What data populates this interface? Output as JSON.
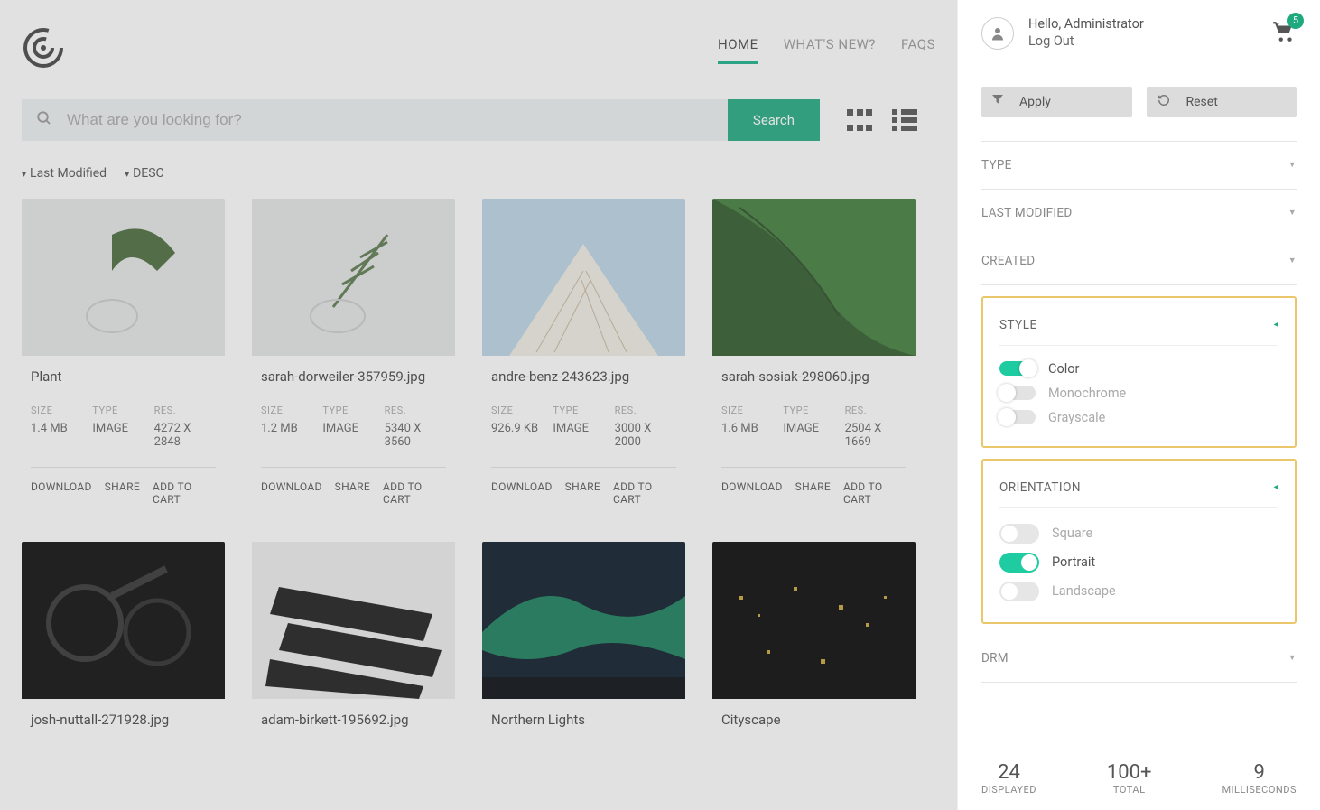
{
  "nav": {
    "home": "HOME",
    "whatsnew": "WHAT'S NEW?",
    "faqs": "FAQS"
  },
  "search": {
    "placeholder": "What are you looking for?",
    "button": "Search"
  },
  "sort": {
    "field": "Last Modified",
    "dir": "DESC"
  },
  "labels": {
    "size": "SIZE",
    "type": "TYPE",
    "res": "RES."
  },
  "actions": {
    "download": "DOWNLOAD",
    "share": "SHARE",
    "addcart": "ADD TO CART"
  },
  "cards": [
    {
      "title": "Plant",
      "size": "1.4 MB",
      "type": "IMAGE",
      "res": "4272 X 2848"
    },
    {
      "title": "sarah-dorweiler-357959.jpg",
      "size": "1.2 MB",
      "type": "IMAGE",
      "res": "5340 X 3560"
    },
    {
      "title": "andre-benz-243623.jpg",
      "size": "926.9 KB",
      "type": "IMAGE",
      "res": "3000 X 2000"
    },
    {
      "title": "sarah-sosiak-298060.jpg",
      "size": "1.6 MB",
      "type": "IMAGE",
      "res": "2504 X 1669"
    },
    {
      "title": "josh-nuttall-271928.jpg"
    },
    {
      "title": "adam-birkett-195692.jpg"
    },
    {
      "title": "Northern Lights"
    },
    {
      "title": "Cityscape"
    }
  ],
  "user": {
    "greeting": "Hello, Administrator",
    "logout": "Log Out",
    "cart_count": "5"
  },
  "filterbtns": {
    "apply": "Apply",
    "reset": "Reset"
  },
  "filters": {
    "type": "TYPE",
    "lastmod": "LAST MODIFIED",
    "created": "CREATED",
    "drm": "DRM"
  },
  "style": {
    "title": "STYLE",
    "options": {
      "color": "Color",
      "mono": "Monochrome",
      "gray": "Grayscale"
    }
  },
  "orientation": {
    "title": "ORIENTATION",
    "options": {
      "square": "Square",
      "portrait": "Portrait",
      "landscape": "Landscape"
    }
  },
  "stats": {
    "displayed": {
      "n": "24",
      "t": "DISPLAYED"
    },
    "total": {
      "n": "100+",
      "t": "TOTAL"
    },
    "ms": {
      "n": "9",
      "t": "MILLISECONDS"
    }
  }
}
